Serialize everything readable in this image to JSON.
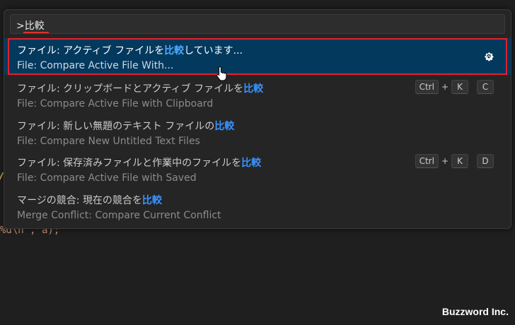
{
  "search": {
    "value": ">比較"
  },
  "items": [
    {
      "label_prefix": "ファイル: アクティブ ファイルを",
      "label_hl": "比較",
      "label_suffix": "しています...",
      "detail": "File: Compare Active File With...",
      "keys": []
    },
    {
      "label_prefix": "ファイル: クリップボードとアクティブ ファイルを",
      "label_hl": "比較",
      "label_suffix": "",
      "detail": "File: Compare Active File with Clipboard",
      "keys": [
        "Ctrl",
        "+",
        "K",
        "C"
      ]
    },
    {
      "label_prefix": "ファイル: 新しい無題のテキスト ファイルの",
      "label_hl": "比較",
      "label_suffix": "",
      "detail": "File: Compare New Untitled Text Files",
      "keys": []
    },
    {
      "label_prefix": "ファイル: 保存済みファイルと作業中のファイルを",
      "label_hl": "比較",
      "label_suffix": "",
      "detail": "File: Compare Active File with Saved",
      "keys": [
        "Ctrl",
        "+",
        "K",
        "D"
      ]
    },
    {
      "label_prefix": "マージの競合: 現在の競合を",
      "label_hl": "比較",
      "label_suffix": "",
      "detail": "Merge Conflict: Compare Current Conflict",
      "keys": []
    }
  ],
  "icons": {
    "gear": "gear-icon",
    "cursor": "hand-pointer-icon"
  },
  "editor": {
    "code_fn": "%d",
    "code_rest": "\\n\", a);"
  },
  "watermark": "Buzzword Inc.",
  "colors": {
    "highlight": "#3794ff",
    "selection_bg": "#04395e",
    "annotation_red": "#e0222c"
  }
}
